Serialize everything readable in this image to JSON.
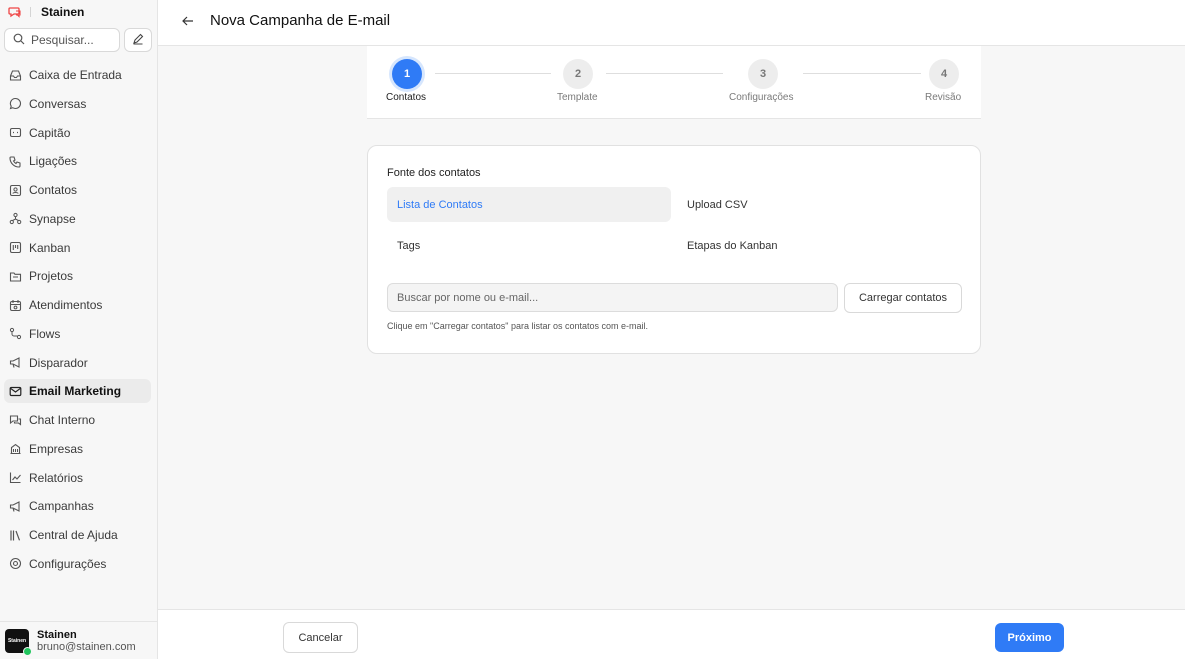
{
  "app": {
    "brand": "Stainen",
    "logo_icon": "chat-bubble-logo-icon",
    "accent": "#2f7bf6"
  },
  "sidebar": {
    "search_placeholder": "Pesquisar...",
    "items": [
      {
        "label": "Caixa de Entrada",
        "icon": "inbox-icon"
      },
      {
        "label": "Conversas",
        "icon": "chat-icon"
      },
      {
        "label": "Capitão",
        "icon": "message-square-icon"
      },
      {
        "label": "Ligações",
        "icon": "phone-icon"
      },
      {
        "label": "Contatos",
        "icon": "contact-card-icon"
      },
      {
        "label": "Synapse",
        "icon": "network-icon"
      },
      {
        "label": "Kanban",
        "icon": "kanban-icon"
      },
      {
        "label": "Projetos",
        "icon": "folder-icon"
      },
      {
        "label": "Atendimentos",
        "icon": "calendar-icon"
      },
      {
        "label": "Flows",
        "icon": "flow-icon"
      },
      {
        "label": "Disparador",
        "icon": "megaphone-icon"
      },
      {
        "label": "Email Marketing",
        "icon": "mail-icon",
        "active": true
      },
      {
        "label": "Chat Interno",
        "icon": "chats-icon"
      },
      {
        "label": "Empresas",
        "icon": "building-icon"
      },
      {
        "label": "Relatórios",
        "icon": "line-chart-icon"
      },
      {
        "label": "Campanhas",
        "icon": "megaphone-icon"
      },
      {
        "label": "Central de Ajuda",
        "icon": "library-icon"
      },
      {
        "label": "Configurações",
        "icon": "settings-icon"
      }
    ]
  },
  "user": {
    "name": "Stainen",
    "email": "bruno@stainen.com",
    "avatar_text": "Stainen",
    "status_color": "#22c55e"
  },
  "header": {
    "title": "Nova Campanha de E-mail"
  },
  "steps": [
    {
      "number": "1",
      "label": "Contatos",
      "active": true
    },
    {
      "number": "2",
      "label": "Template"
    },
    {
      "number": "3",
      "label": "Configurações"
    },
    {
      "number": "4",
      "label": "Revisão"
    }
  ],
  "source": {
    "title": "Fonte dos contatos",
    "options": [
      {
        "label": "Lista de Contatos",
        "selected": true
      },
      {
        "label": "Upload CSV"
      },
      {
        "label": "Tags"
      },
      {
        "label": "Etapas do Kanban"
      }
    ],
    "search_placeholder": "Buscar por nome ou e-mail...",
    "load_button": "Carregar contatos",
    "hint": "Clique em \"Carregar contatos\" para listar os contatos com e-mail."
  },
  "footer": {
    "cancel_label": "Cancelar",
    "next_label": "Próximo"
  }
}
